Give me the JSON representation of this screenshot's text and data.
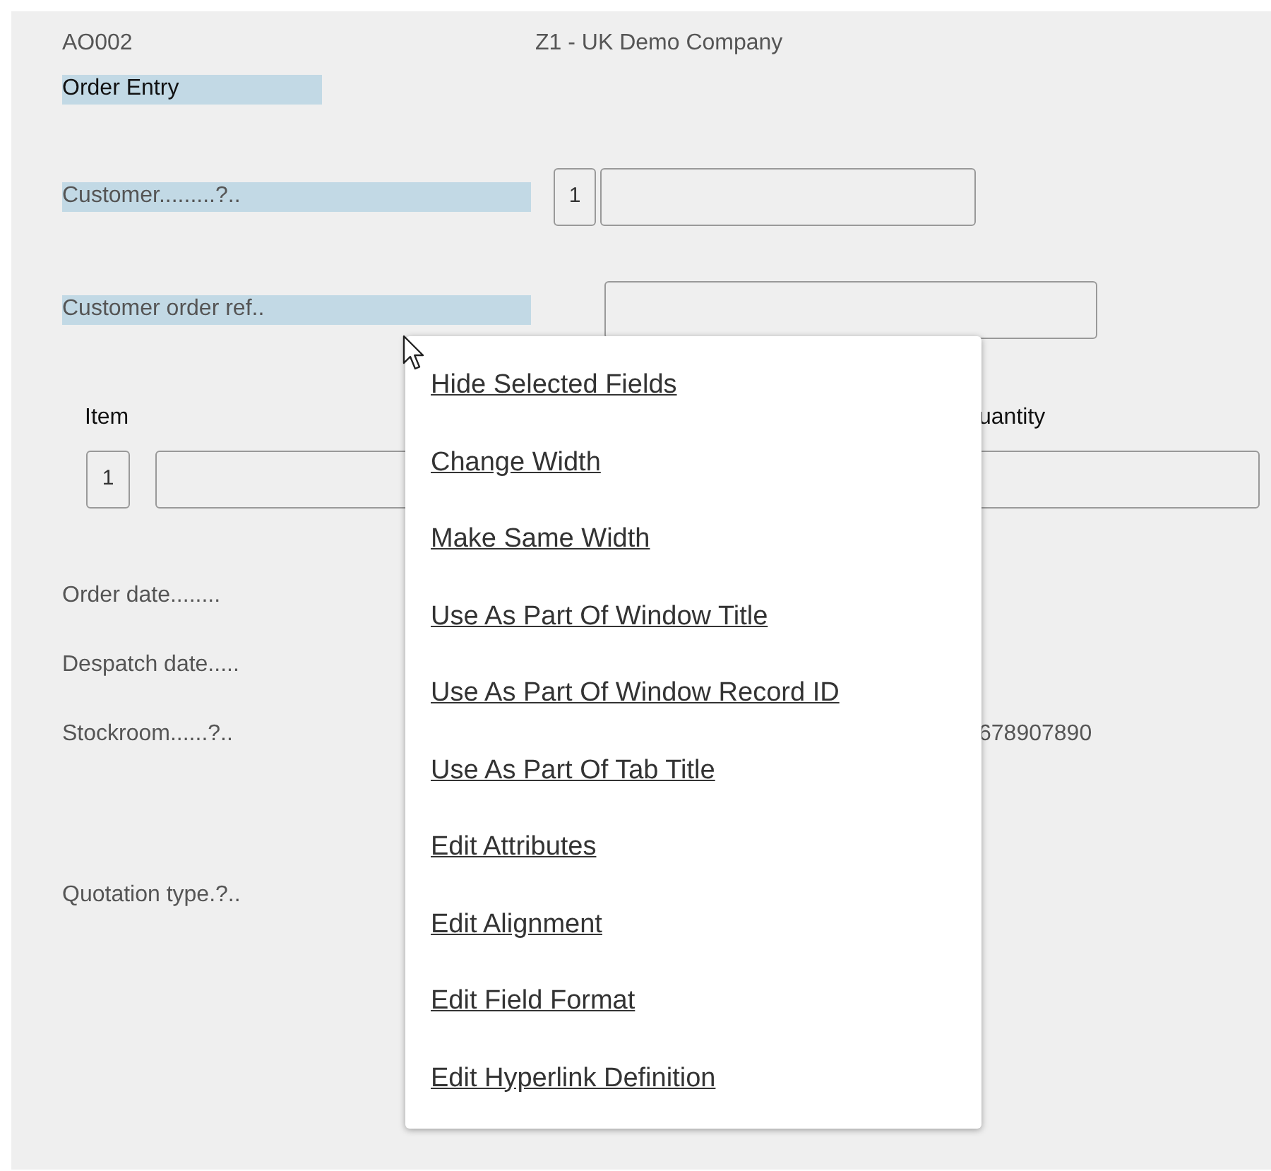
{
  "header": {
    "program_code": "AO002",
    "company": "Z1 - UK Demo Company"
  },
  "title": {
    "text": "Order Entry",
    "selected": true
  },
  "fields": [
    {
      "kind": "prompt",
      "label": "Customer.........?..",
      "selected": true,
      "prefix": "1"
    },
    {
      "kind": "input",
      "label": "Customer order ref..",
      "selected": true
    }
  ],
  "grid": {
    "columns": [
      {
        "heading": "Item"
      },
      {
        "heading": "uantity"
      }
    ],
    "row_number": "1"
  },
  "info_rows": [
    {
      "label": "Order date........",
      "selected": false
    },
    {
      "label": "Despatch date.....",
      "selected": false
    },
    {
      "label": "Stockroom......?..",
      "selected": false,
      "value": "678907890"
    },
    {
      "label": "Quotation type.?..",
      "selected": false
    }
  ],
  "context_menu": {
    "items": [
      {
        "label": "Hide Selected Fields"
      },
      {
        "label": "Change Width"
      },
      {
        "label": "Make Same Width"
      },
      {
        "label": "Use As Part Of Window Title"
      },
      {
        "label": "Use As Part Of Window Record ID"
      },
      {
        "label": "Use As Part Of Tab Title"
      },
      {
        "label": "Edit Attributes"
      },
      {
        "label": "Edit Alignment"
      },
      {
        "label": "Edit Field Format"
      },
      {
        "label": "Edit Hyperlink Definition"
      }
    ]
  }
}
